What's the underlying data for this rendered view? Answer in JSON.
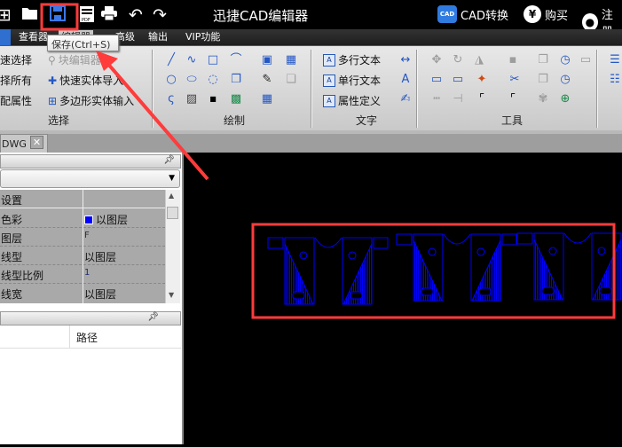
{
  "titlebar": {
    "title": "迅捷CAD编辑器",
    "quick_icons": [
      "new-icon",
      "open-folder-icon",
      "save-icon",
      "pdf-icon",
      "print-icon",
      "undo-icon",
      "redo-icon"
    ],
    "cad_convert": "CAD转换",
    "cad_badge": "CAD",
    "buy": "购买",
    "buy_symbol": "¥",
    "register": "注册"
  },
  "menubar": {
    "items": [
      "查看器",
      "编辑器",
      "高级",
      "输出",
      "VIP功能"
    ],
    "active": "编辑器"
  },
  "tooltip": "保存(Ctrl+S)",
  "ribbon": {
    "select": {
      "label": "选择",
      "items": [
        "快速选择",
        "选择所有",
        "匹配属性"
      ],
      "items2": [
        "块编辑器",
        "快速实体导入",
        "多边形实体输入"
      ]
    },
    "draw": {
      "label": "绘制"
    },
    "text": {
      "label": "文字",
      "items": [
        "多行文本",
        "单行文本",
        "属性定义"
      ]
    },
    "tools": {
      "label": "工具"
    }
  },
  "doc_tab": {
    "label": "DWG",
    "close": "✕"
  },
  "properties": {
    "section": "设置",
    "rows": [
      {
        "key": "色彩",
        "value": "以图层",
        "swatch": "#0000ff"
      },
      {
        "key": "图层",
        "value": "F"
      },
      {
        "key": "线型",
        "value": "以图层"
      },
      {
        "key": "线型比例",
        "value": "1"
      },
      {
        "key": "线宽",
        "value": "以图层"
      }
    ]
  },
  "file_list": {
    "columns": [
      "路径"
    ]
  },
  "colors": {
    "highlight": "#ff3b3b",
    "drawing": "#0000ff",
    "canvas": "#000000"
  }
}
